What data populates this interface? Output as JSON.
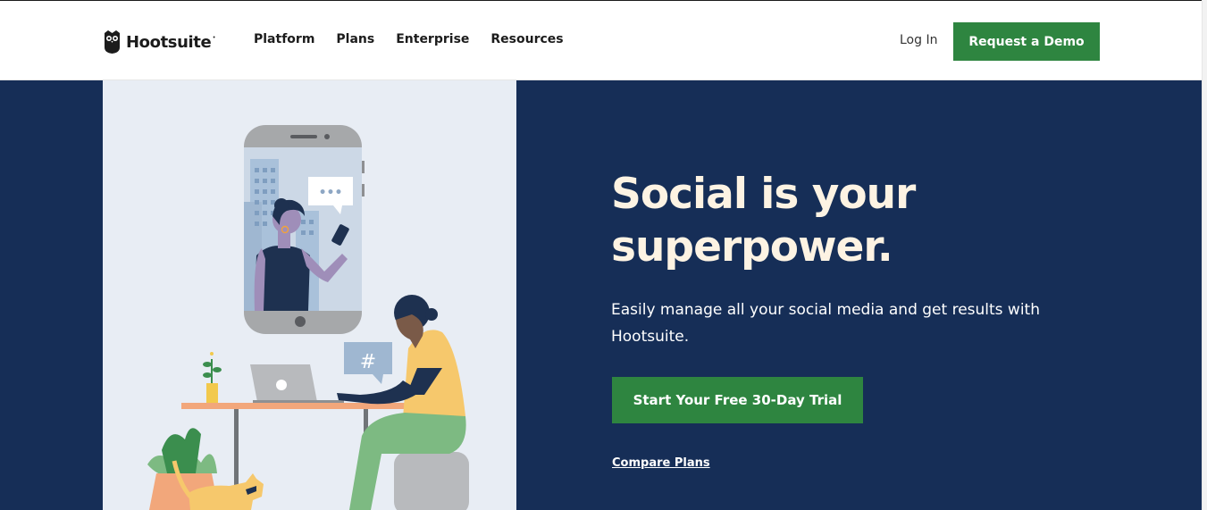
{
  "header": {
    "logo_text": "Hootsuite",
    "logo_mark": "•",
    "nav": [
      {
        "label": "Platform"
      },
      {
        "label": "Plans"
      },
      {
        "label": "Enterprise"
      },
      {
        "label": "Resources"
      }
    ],
    "login_label": "Log In",
    "demo_button_label": "Request a Demo"
  },
  "hero": {
    "headline_line1": "Social is your",
    "headline_line2": "superpower.",
    "subtext": "Easily manage all your social media and get results with Hootsuite.",
    "trial_button_label": "Start Your Free 30-Day Trial",
    "compare_label": "Compare Plans",
    "illustration": {
      "chat_bubble_text": "•••",
      "hashtag_bubble_text": "#"
    }
  },
  "colors": {
    "brand_green": "#2e8540",
    "hero_navy": "#162e57",
    "headline_cream": "#fdf3e3",
    "illustration_bg": "#e8edf4"
  },
  "icons": [
    "hootsuite-owl-icon"
  ]
}
